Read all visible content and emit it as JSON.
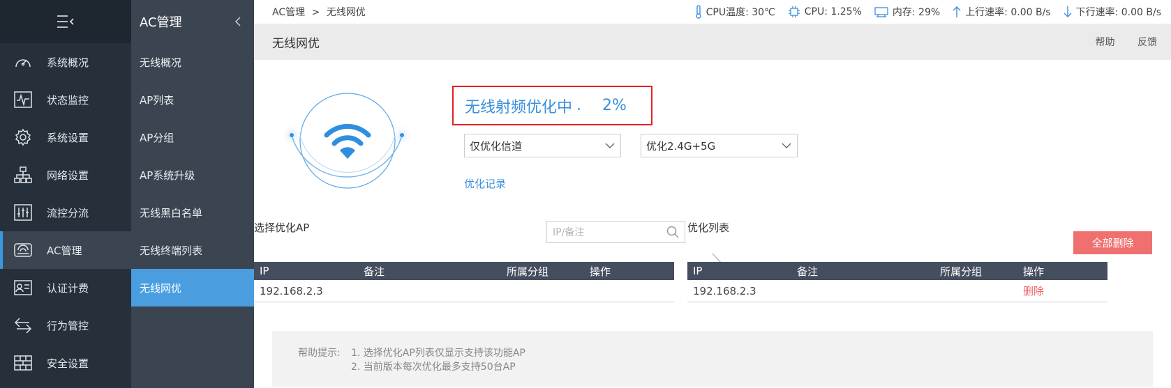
{
  "sidebar": {
    "items": [
      {
        "label": "系统概况",
        "icon": "dashboard-icon"
      },
      {
        "label": "状态监控",
        "icon": "pulse-icon"
      },
      {
        "label": "系统设置",
        "icon": "gear-icon"
      },
      {
        "label": "网络设置",
        "icon": "network-icon"
      },
      {
        "label": "流控分流",
        "icon": "sliders-icon"
      },
      {
        "label": "AC管理",
        "icon": "router-icon"
      },
      {
        "label": "认证计费",
        "icon": "id-card-icon"
      },
      {
        "label": "行为管控",
        "icon": "swap-icon"
      },
      {
        "label": "安全设置",
        "icon": "firewall-icon"
      }
    ]
  },
  "subnav": {
    "title": "AC管理",
    "items": [
      "无线概况",
      "AP列表",
      "AP分组",
      "AP系统升级",
      "无线黑白名单",
      "无线终端列表",
      "无线网优"
    ]
  },
  "topbar": {
    "breadcrumb_root": "AC管理",
    "breadcrumb_sep": ">",
    "breadcrumb_current": "无线网优",
    "cpu_temp": "CPU温度: 30℃",
    "cpu": "CPU: 1.25%",
    "memory": "内存: 29%",
    "upload": "上行速率: 0.00 B/s",
    "download": "下行速率: 0.00 B/s"
  },
  "page": {
    "title": "无线网优",
    "help_link": "帮助",
    "feedback_link": "反馈"
  },
  "optimize": {
    "status_text": "无线射频优化中",
    "dots": ".",
    "progress": "2%",
    "mode_select": "仅优化信道",
    "band_select": "优化2.4G+5G",
    "record_link": "优化记录"
  },
  "left_panel": {
    "label": "选择优化AP",
    "search_placeholder": "IP/备注",
    "columns": [
      "IP",
      "备注",
      "所属分组",
      "操作"
    ],
    "rows": [
      {
        "ip": "192.168.2.3",
        "note": "",
        "group": "",
        "op": ""
      }
    ]
  },
  "right_panel": {
    "label": "优化列表",
    "delete_all": "全部删除",
    "columns": [
      "IP",
      "备注",
      "所属分组",
      "操作"
    ],
    "rows": [
      {
        "ip": "192.168.2.3",
        "note": "",
        "group": "",
        "op": "删除"
      }
    ]
  },
  "help": {
    "label": "帮助提示:",
    "line1": "1. 选择优化AP列表仅显示支持该功能AP",
    "line2": "2. 当前版本每次优化最多支持50台AP"
  },
  "colors": {
    "accent": "#3a8fdc",
    "sidebar_bg": "#26303b",
    "subnav_bg": "#3b4552",
    "danger": "#f07070",
    "highlight_border": "#e52020"
  }
}
